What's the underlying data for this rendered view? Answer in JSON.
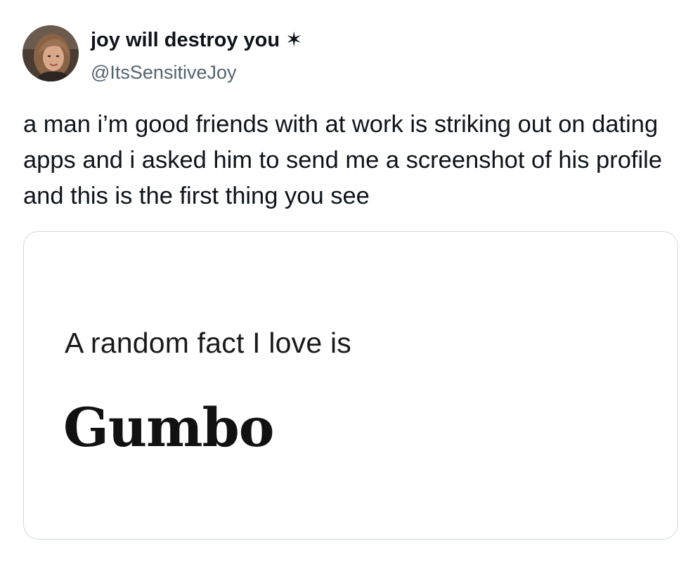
{
  "author": {
    "display_name": "joy will destroy you ✶",
    "handle": "@ItsSensitiveJoy"
  },
  "tweet": {
    "text": "a man i’m good friends with at work is striking out on dating apps and i asked him to send me a screenshot of his profile and this is the first thing you see"
  },
  "attached_image": {
    "prompt_label": "A random fact I love is",
    "prompt_answer": "Gumbo"
  }
}
